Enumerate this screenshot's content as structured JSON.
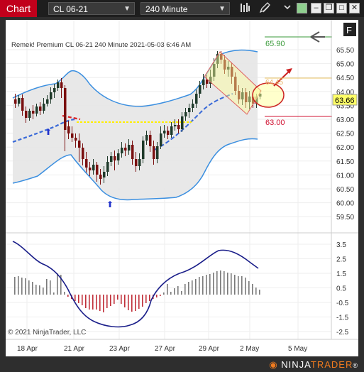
{
  "titlebar": {
    "chart_tab": "Chart",
    "instrument": "CL 06-21",
    "interval": "240 Minute",
    "icons": [
      "bars-icon",
      "draw-pencil-icon",
      "chevron-down-icon"
    ],
    "window_buttons": [
      "minimize",
      "maximize",
      "restore",
      "close"
    ]
  },
  "chart": {
    "header_label": "Remek!  Premium  CL 06-21  240 Minute  2021-05-03 6:46 AM",
    "copyright": "© 2021 NinjaTrader, LLC",
    "f_button": "F",
    "back_arrow_icon": "left-arrow-icon",
    "levels": {
      "target_label": "65.90",
      "entry_label": "64.45",
      "stop_label": "63.00",
      "current_price": "63.66"
    },
    "price_axis_ticks": [
      "65.50",
      "65.00",
      "64.50",
      "64.00",
      "63.50",
      "63.00",
      "62.50",
      "62.00",
      "61.50",
      "61.00",
      "60.50",
      "60.00",
      "59.50"
    ],
    "indicator_axis_ticks": [
      "3.5",
      "2.5",
      "1.5",
      "0.5",
      "-0.5",
      "-1.5",
      "-2.5"
    ],
    "time_axis_ticks": [
      "18 Apr",
      "21 Apr",
      "23 Apr",
      "27 Apr",
      "29 Apr",
      "2 May",
      "5 May"
    ],
    "colors": {
      "up_candle": "#1f3a2a",
      "down_candle": "#7a1010",
      "band": "#3b8fe0",
      "midline": "#3a6ad8",
      "zone_yellow": "#ffff00",
      "target_green": "#3a9a3a",
      "stop_red": "#d01030",
      "price_box": "#ffff66"
    }
  },
  "footer": {
    "logo_left": "NINJA",
    "logo_right": "TRADER",
    "logo_mark": "®"
  }
}
